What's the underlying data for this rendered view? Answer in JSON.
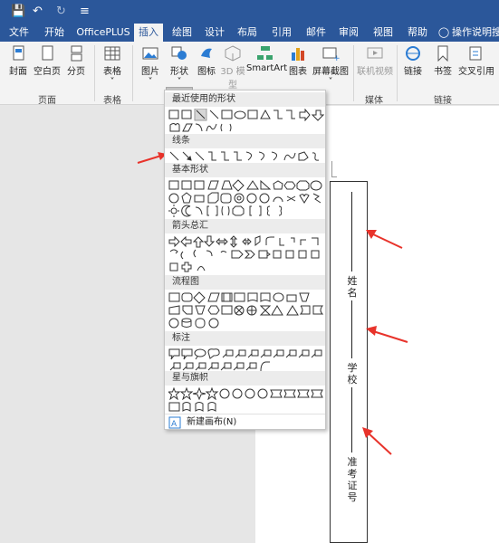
{
  "ribbon_tabs": [
    "文件",
    "开始",
    "OfficePLUS",
    "插入",
    "绘图",
    "设计",
    "布局",
    "引用",
    "邮件",
    "审阅",
    "视图",
    "帮助",
    "操作说明搜"
  ],
  "active_tab": "插入",
  "title_icons": [
    "save-icon",
    "undo-icon",
    "redo-icon",
    "customize-icon"
  ],
  "ribbon": {
    "pages_group": {
      "label": "页面",
      "buttons": [
        "封面",
        "空白页",
        "分页"
      ]
    },
    "table_group": {
      "label": "表格",
      "buttons": [
        "表格"
      ]
    },
    "illustrations": {
      "buttons": [
        "图片",
        "形状",
        "图标",
        "3D 模型",
        "SmartArt",
        "图表",
        "屏幕截图"
      ]
    },
    "media_group": {
      "label": "媒体",
      "buttons": [
        "联机视频"
      ]
    },
    "links_group": {
      "label": "链接",
      "buttons": [
        "链接",
        "书签",
        "交叉引用"
      ]
    }
  },
  "shapes_menu": {
    "sections": [
      "最近使用的形状",
      "线条",
      "基本形状",
      "箭头总汇",
      "流程图",
      "标注",
      "星与旗帜"
    ],
    "footer": "新建画布(N)"
  },
  "textbox_labels": [
    "姓名",
    "学校",
    "准考证号"
  ],
  "colors": {
    "ribbon_blue": "#2b579a",
    "arrow_red": "#e8332b"
  }
}
